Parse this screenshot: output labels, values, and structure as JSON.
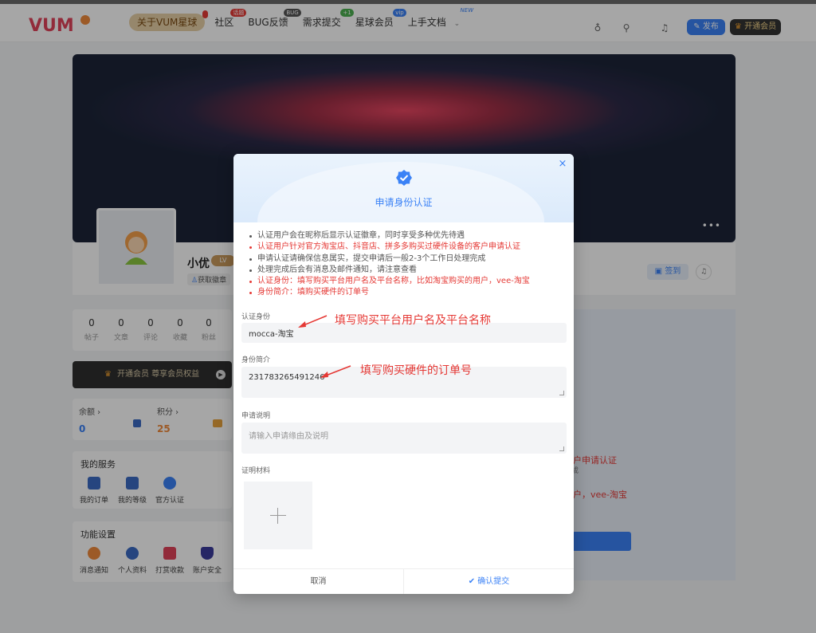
{
  "header": {
    "logo": "VUM",
    "nav": [
      {
        "label": "关于VUM星球",
        "badge": ""
      },
      {
        "label": "社区",
        "badge": "话题"
      },
      {
        "label": "BUG反馈",
        "badge": "BUG"
      },
      {
        "label": "需求提交",
        "badge": "+1"
      },
      {
        "label": "星球会员",
        "badge": "vip"
      },
      {
        "label": "上手文档",
        "badge": "NEW"
      }
    ],
    "publish_label": "发布",
    "vip_label": "开通会员"
  },
  "profile": {
    "username": "小优",
    "level": "LV",
    "get_badge": "获取徽章",
    "sign_label": "签到",
    "stats": [
      {
        "num": "0",
        "label": "帖子"
      },
      {
        "num": "0",
        "label": "文章"
      },
      {
        "num": "0",
        "label": "评论"
      },
      {
        "num": "0",
        "label": "收藏"
      },
      {
        "num": "0",
        "label": "粉丝"
      }
    ],
    "vip_bar": "开通会员 尊享会员权益",
    "balance": {
      "label": "余额",
      "value": "0"
    },
    "points": {
      "label": "积分",
      "value": "25"
    },
    "services_title": "我的服务",
    "services": [
      "我的订单",
      "我的等级",
      "官方认证"
    ],
    "functions_title": "功能设置",
    "functions": [
      "消息通知",
      "个人资料",
      "打赏收款",
      "账户安全"
    ],
    "right_text1": "客户申请认证",
    "right_text2": "完成",
    "right_text3": "用户，vee-淘宝"
  },
  "modal": {
    "title": "申请身份认证",
    "notes": [
      {
        "text": "认证用户会在昵称后显示认证徽章，同时享受多种优先待遇",
        "red": false
      },
      {
        "text": "认证用户针对官方淘宝店、抖音店、拼多多购买过硬件设备的客户申请认证",
        "red": true
      },
      {
        "text": "申请认证请确保信息属实，提交申请后一般2-3个工作日处理完成",
        "red": false
      },
      {
        "text": "处理完成后会有消息及邮件通知，请注意查看",
        "red": false
      },
      {
        "text": "认证身份：填写购买平台用户名及平台名称，比如淘宝购买的用户，vee-淘宝",
        "red": true
      },
      {
        "text": "身份简介：填购买硬件的订单号",
        "red": true
      }
    ],
    "identity_label": "认证身份",
    "identity_value": "mocca-淘宝",
    "intro_label": "身份简介",
    "intro_value": "231783265491246",
    "desc_label": "申请说明",
    "desc_placeholder": "请输入申请缘由及说明",
    "material_label": "证明材料",
    "cancel_label": "取消",
    "confirm_label": "确认提交"
  },
  "annotations": {
    "identity_note": "填写购买平台用户名及平台名称",
    "intro_note": "填写购买硬件的订单号"
  },
  "colors": {
    "accent": "#3b82f6",
    "warning": "#e53935",
    "vip_gold": "#e7cfa6"
  }
}
